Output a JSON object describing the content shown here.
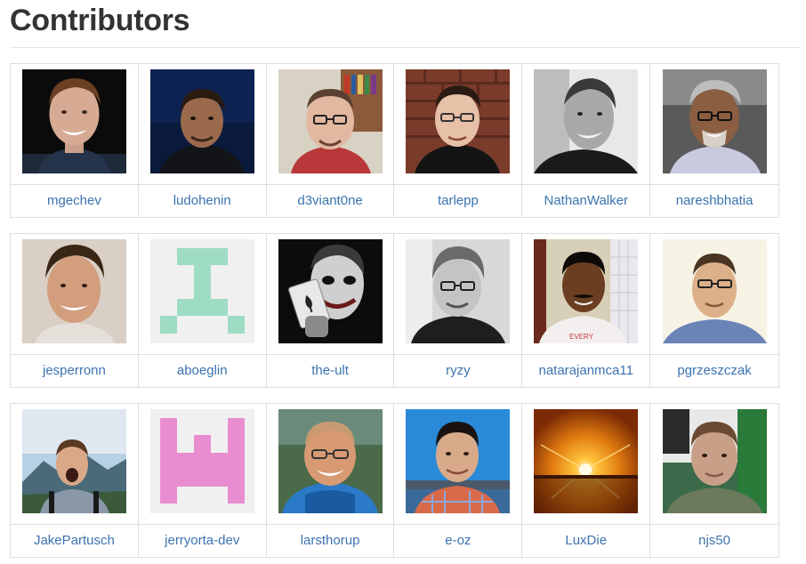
{
  "page": {
    "title": "Contributors"
  },
  "colors": {
    "link": "#3b73af",
    "border": "#dddddd",
    "title": "#333333"
  },
  "rows": [
    [
      {
        "name": "mgechev",
        "avatar": "photo-portrait"
      },
      {
        "name": "ludohenin",
        "avatar": "photo-portrait-dark"
      },
      {
        "name": "d3viant0ne",
        "avatar": "photo-portrait-glasses"
      },
      {
        "name": "tarlepp",
        "avatar": "photo-portrait-glasses"
      },
      {
        "name": "NathanWalker",
        "avatar": "photo-portrait-bw"
      },
      {
        "name": "nareshbhatia",
        "avatar": "photo-portrait-glasses"
      }
    ],
    [
      {
        "name": "jesperronn",
        "avatar": "photo-portrait"
      },
      {
        "name": "aboeglin",
        "avatar": "identicon-mint"
      },
      {
        "name": "the-ult",
        "avatar": "photo-joker-card"
      },
      {
        "name": "ryzy",
        "avatar": "photo-portrait-bw-glasses"
      },
      {
        "name": "natarajanmca11",
        "avatar": "photo-portrait"
      },
      {
        "name": "pgrzeszczak",
        "avatar": "photo-portrait-glasses"
      }
    ],
    [
      {
        "name": "JakePartusch",
        "avatar": "photo-mountain-shout"
      },
      {
        "name": "jerryorta-dev",
        "avatar": "identicon-pink"
      },
      {
        "name": "larsthorup",
        "avatar": "photo-portrait-glasses"
      },
      {
        "name": "e-oz",
        "avatar": "photo-portrait"
      },
      {
        "name": "LuxDie",
        "avatar": "photo-sunset"
      },
      {
        "name": "njs50",
        "avatar": "photo-portrait"
      }
    ]
  ]
}
